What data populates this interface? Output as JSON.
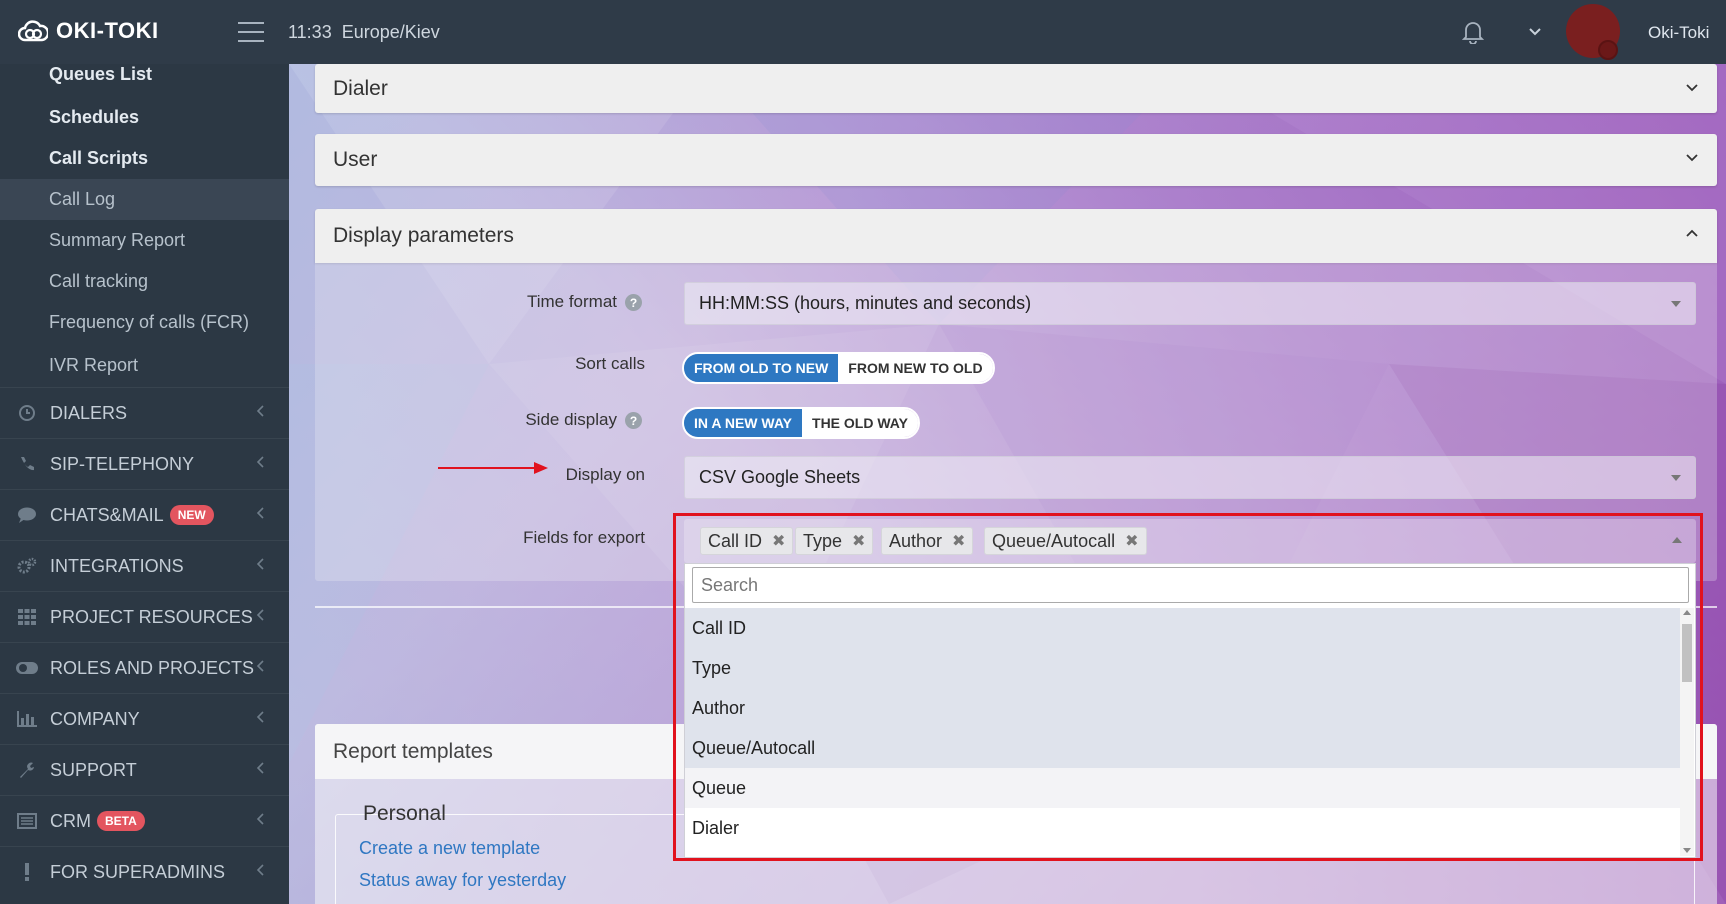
{
  "topbar": {
    "brand": "OKI-TOKI",
    "time": "11:33",
    "timezone": "Europe/Kiev",
    "user_name": "Oki-Toki",
    "icons": [
      "cloud-logo-icon",
      "hamburger-icon",
      "bell-icon",
      "chevron-down-icon"
    ]
  },
  "sidebar": {
    "sub_items": [
      {
        "label": "Queues List"
      },
      {
        "label": "Schedules"
      },
      {
        "label": "Call Scripts"
      },
      {
        "label": "Call Log"
      },
      {
        "label": "Summary Report"
      },
      {
        "label": "Call tracking"
      },
      {
        "label": "Frequency of calls (FCR)"
      },
      {
        "label": "IVR Report"
      }
    ],
    "nav_items": [
      {
        "label": "DIALERS",
        "icon": "clock-icon"
      },
      {
        "label": "SIP-TELEPHONY",
        "icon": "phone-icon"
      },
      {
        "label": "CHATS&MAIL",
        "icon": "chat-icon",
        "badge": "NEW"
      },
      {
        "label": "INTEGRATIONS",
        "icon": "gears-icon"
      },
      {
        "label": "PROJECT RESOURCES",
        "icon": "grid-icon"
      },
      {
        "label": "ROLES AND PROJECTS",
        "icon": "toggle-icon"
      },
      {
        "label": "COMPANY",
        "icon": "bar-chart-icon"
      },
      {
        "label": "SUPPORT",
        "icon": "wrench-icon"
      },
      {
        "label": "CRM",
        "icon": "list-icon",
        "badge": "BETA"
      },
      {
        "label": "FOR SUPERADMINS",
        "icon": "exclamation-icon"
      }
    ]
  },
  "panels": {
    "dialer": "Dialer",
    "user": "User",
    "display_parameters": "Display parameters"
  },
  "display": {
    "time_format_label": "Time format",
    "time_format_value": "HH:MM:SS (hours, minutes and seconds)",
    "sort_calls_label": "Sort calls",
    "sort_on": "FROM OLD TO NEW",
    "sort_off": "FROM NEW TO OLD",
    "side_display_label": "Side display",
    "side_on": "IN A NEW WAY",
    "side_off": "THE OLD WAY",
    "display_on_label": "Display on",
    "display_on_value": "CSV Google Sheets",
    "fields_label": "Fields for export",
    "help_glyph": "?"
  },
  "fields_export": {
    "selected_tags": [
      "Call ID",
      "Type",
      "Author",
      "Queue/Autocall"
    ],
    "search_placeholder": "Search",
    "options": [
      "Call ID",
      "Type",
      "Author",
      "Queue/Autocall",
      "Queue",
      "Dialer"
    ],
    "remove_glyph": "✖"
  },
  "templates": {
    "title": "Report templates",
    "legend": "Personal",
    "link_new": "Create a new template",
    "link_status": "Status away for yesterday"
  },
  "colors": {
    "accent_blue": "#2e78c2",
    "highlight_red": "#e1121e",
    "badge_red": "#e3555f",
    "sidebar_bg": "#2c3844"
  }
}
